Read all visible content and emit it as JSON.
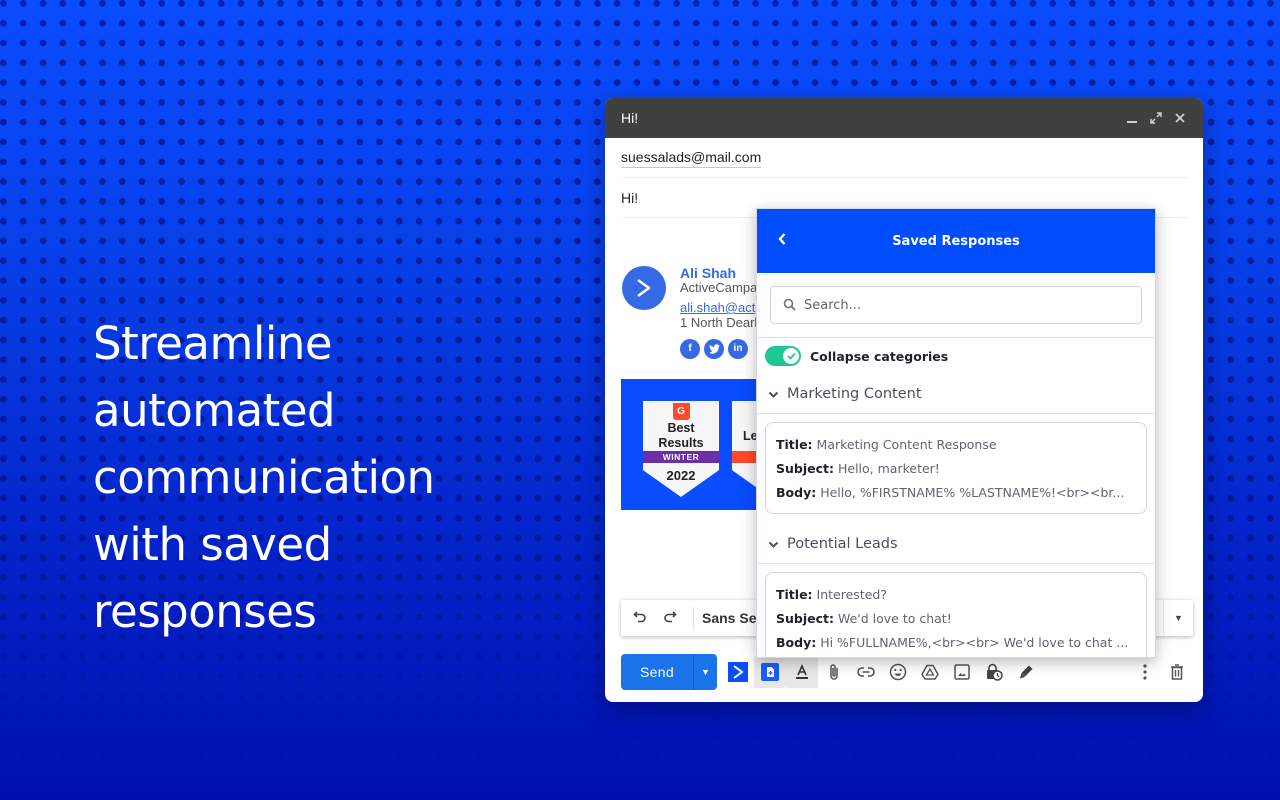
{
  "headline": {
    "lines": [
      "Streamline",
      "automated",
      "communication",
      "with saved",
      "responses"
    ]
  },
  "compose": {
    "window_title": "Hi!",
    "controls": {
      "minimize": "minimize-icon",
      "expand": "expand-icon",
      "close": "close-icon"
    },
    "to": "suessalads@mail.com",
    "subject": "Hi!",
    "signature": {
      "name": "Ali Shah",
      "company": "ActiveCampa",
      "email": "ali.shah@act",
      "address": "1 North Dearl",
      "socials": [
        "f",
        "t",
        "in"
      ]
    },
    "badge": {
      "title1": "Best",
      "title2": "Results",
      "ribbon": "WINTER",
      "year": "2022",
      "partial_title": "Le",
      "logo": "G"
    },
    "format_bar": {
      "font": "Sans Seri",
      "undo": "undo-icon",
      "redo": "redo-icon"
    },
    "send_label": "Send",
    "toolbar_icons": [
      "activecampaign-icon",
      "saved-responses-icon",
      "text-format-icon",
      "attach-icon",
      "link-icon",
      "emoji-icon",
      "drive-icon",
      "photo-icon",
      "confidential-mode-icon",
      "signature-icon",
      "more-options-icon",
      "trash-icon"
    ]
  },
  "panel": {
    "title": "Saved Responses",
    "search_placeholder": "Search...",
    "toggle_label": "Collapse categories",
    "toggle_on": true,
    "categories": [
      {
        "name": "Marketing Content",
        "responses": [
          {
            "title_label": "Title:",
            "title": "Marketing Content Response",
            "subject_label": "Subject:",
            "subject": "Hello, marketer!",
            "body_label": "Body:",
            "body": "Hello, %FIRSTNAME% %LASTNAME%!<br><br..."
          }
        ]
      },
      {
        "name": "Potential Leads",
        "responses": [
          {
            "title_label": "Title:",
            "title": "Interested?",
            "subject_label": "Subject:",
            "subject": "We'd love to chat!",
            "body_label": "Body:",
            "body": "Hi %FULLNAME%,<br><br> We'd love to chat ..."
          }
        ]
      }
    ]
  },
  "colors": {
    "brand_blue": "#004cff",
    "send_blue": "#1a73e8",
    "toggle_green": "#1ec795",
    "header_dark": "#404040"
  }
}
